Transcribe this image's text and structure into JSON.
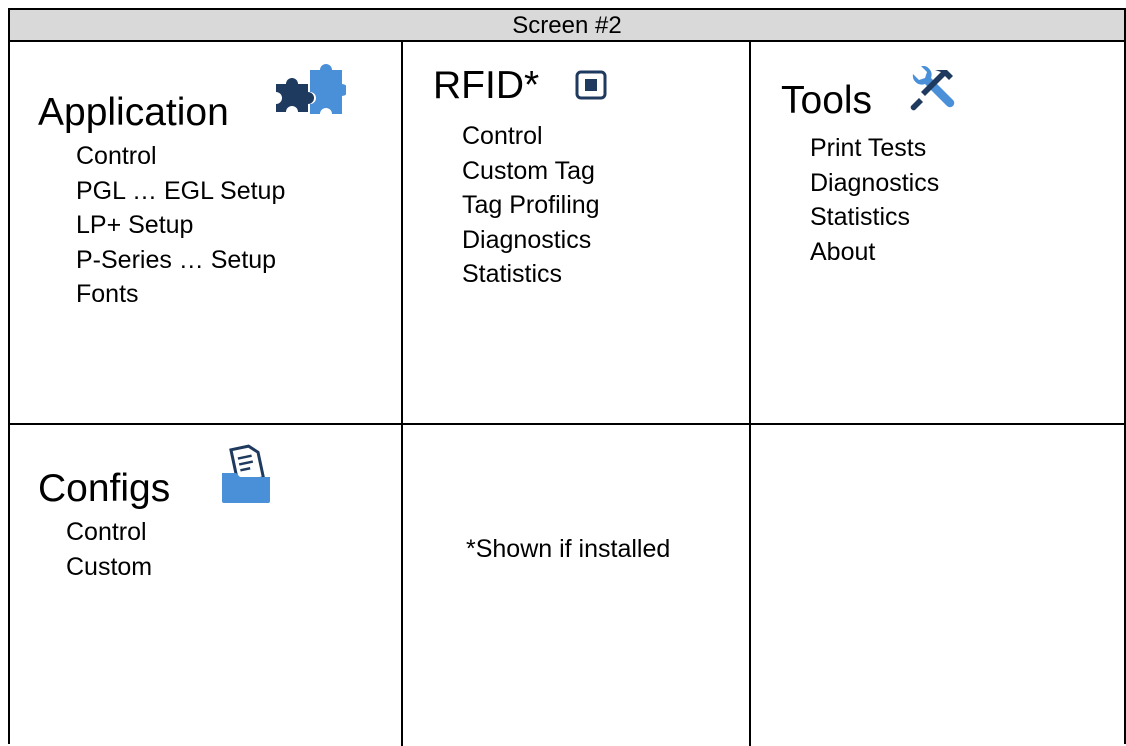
{
  "window": {
    "title": "Screen #2"
  },
  "colors": {
    "title_bar_bg": "#d9d9d9",
    "icon_dark_blue": "#1f3a5f",
    "icon_light_blue": "#4a90d9",
    "grid_lines": "#000000"
  },
  "cells": {
    "application": {
      "heading": "Application",
      "icon": "puzzle-icon",
      "items": [
        "Control",
        "PGL … EGL Setup",
        "LP+ Setup",
        "P-Series … Setup",
        "Fonts"
      ]
    },
    "rfid": {
      "heading": "RFID*",
      "icon": "rfid-chip-icon",
      "items": [
        "Control",
        "Custom Tag",
        "Tag Profiling",
        "Diagnostics",
        "Statistics"
      ]
    },
    "tools": {
      "heading": "Tools",
      "icon": "wrench-hammer-icon",
      "items": [
        "Print Tests",
        "Diagnostics",
        "Statistics",
        "About"
      ]
    },
    "configs": {
      "heading": "Configs",
      "icon": "folder-document-icon",
      "items": [
        "Control",
        "Custom"
      ]
    },
    "note": {
      "text": "*Shown if installed"
    }
  }
}
